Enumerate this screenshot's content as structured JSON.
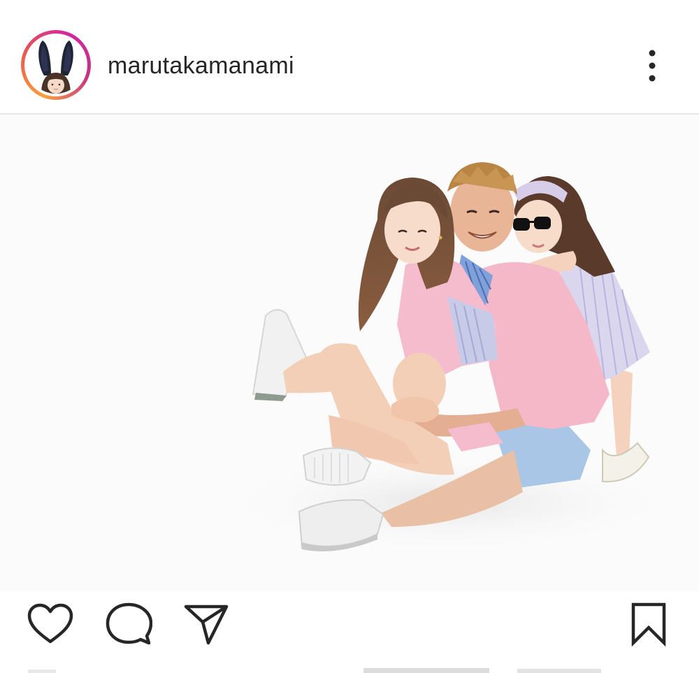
{
  "header": {
    "username": "marutakamanami",
    "avatar_icon": "profile-avatar",
    "more_icon": "more-vertical-icon",
    "story_ring_colors": [
      "#f9a03f",
      "#e95950",
      "#d6249f",
      "#c13584"
    ]
  },
  "post": {
    "image_subject": "family-photo"
  },
  "actions": {
    "like_icon": "heart-icon",
    "comment_icon": "comment-bubble-icon",
    "share_icon": "paper-plane-icon",
    "save_icon": "bookmark-icon",
    "icon_color": "#262626"
  },
  "colors": {
    "text": "#262626",
    "divider": "#e6e6e6",
    "background": "#ffffff"
  }
}
